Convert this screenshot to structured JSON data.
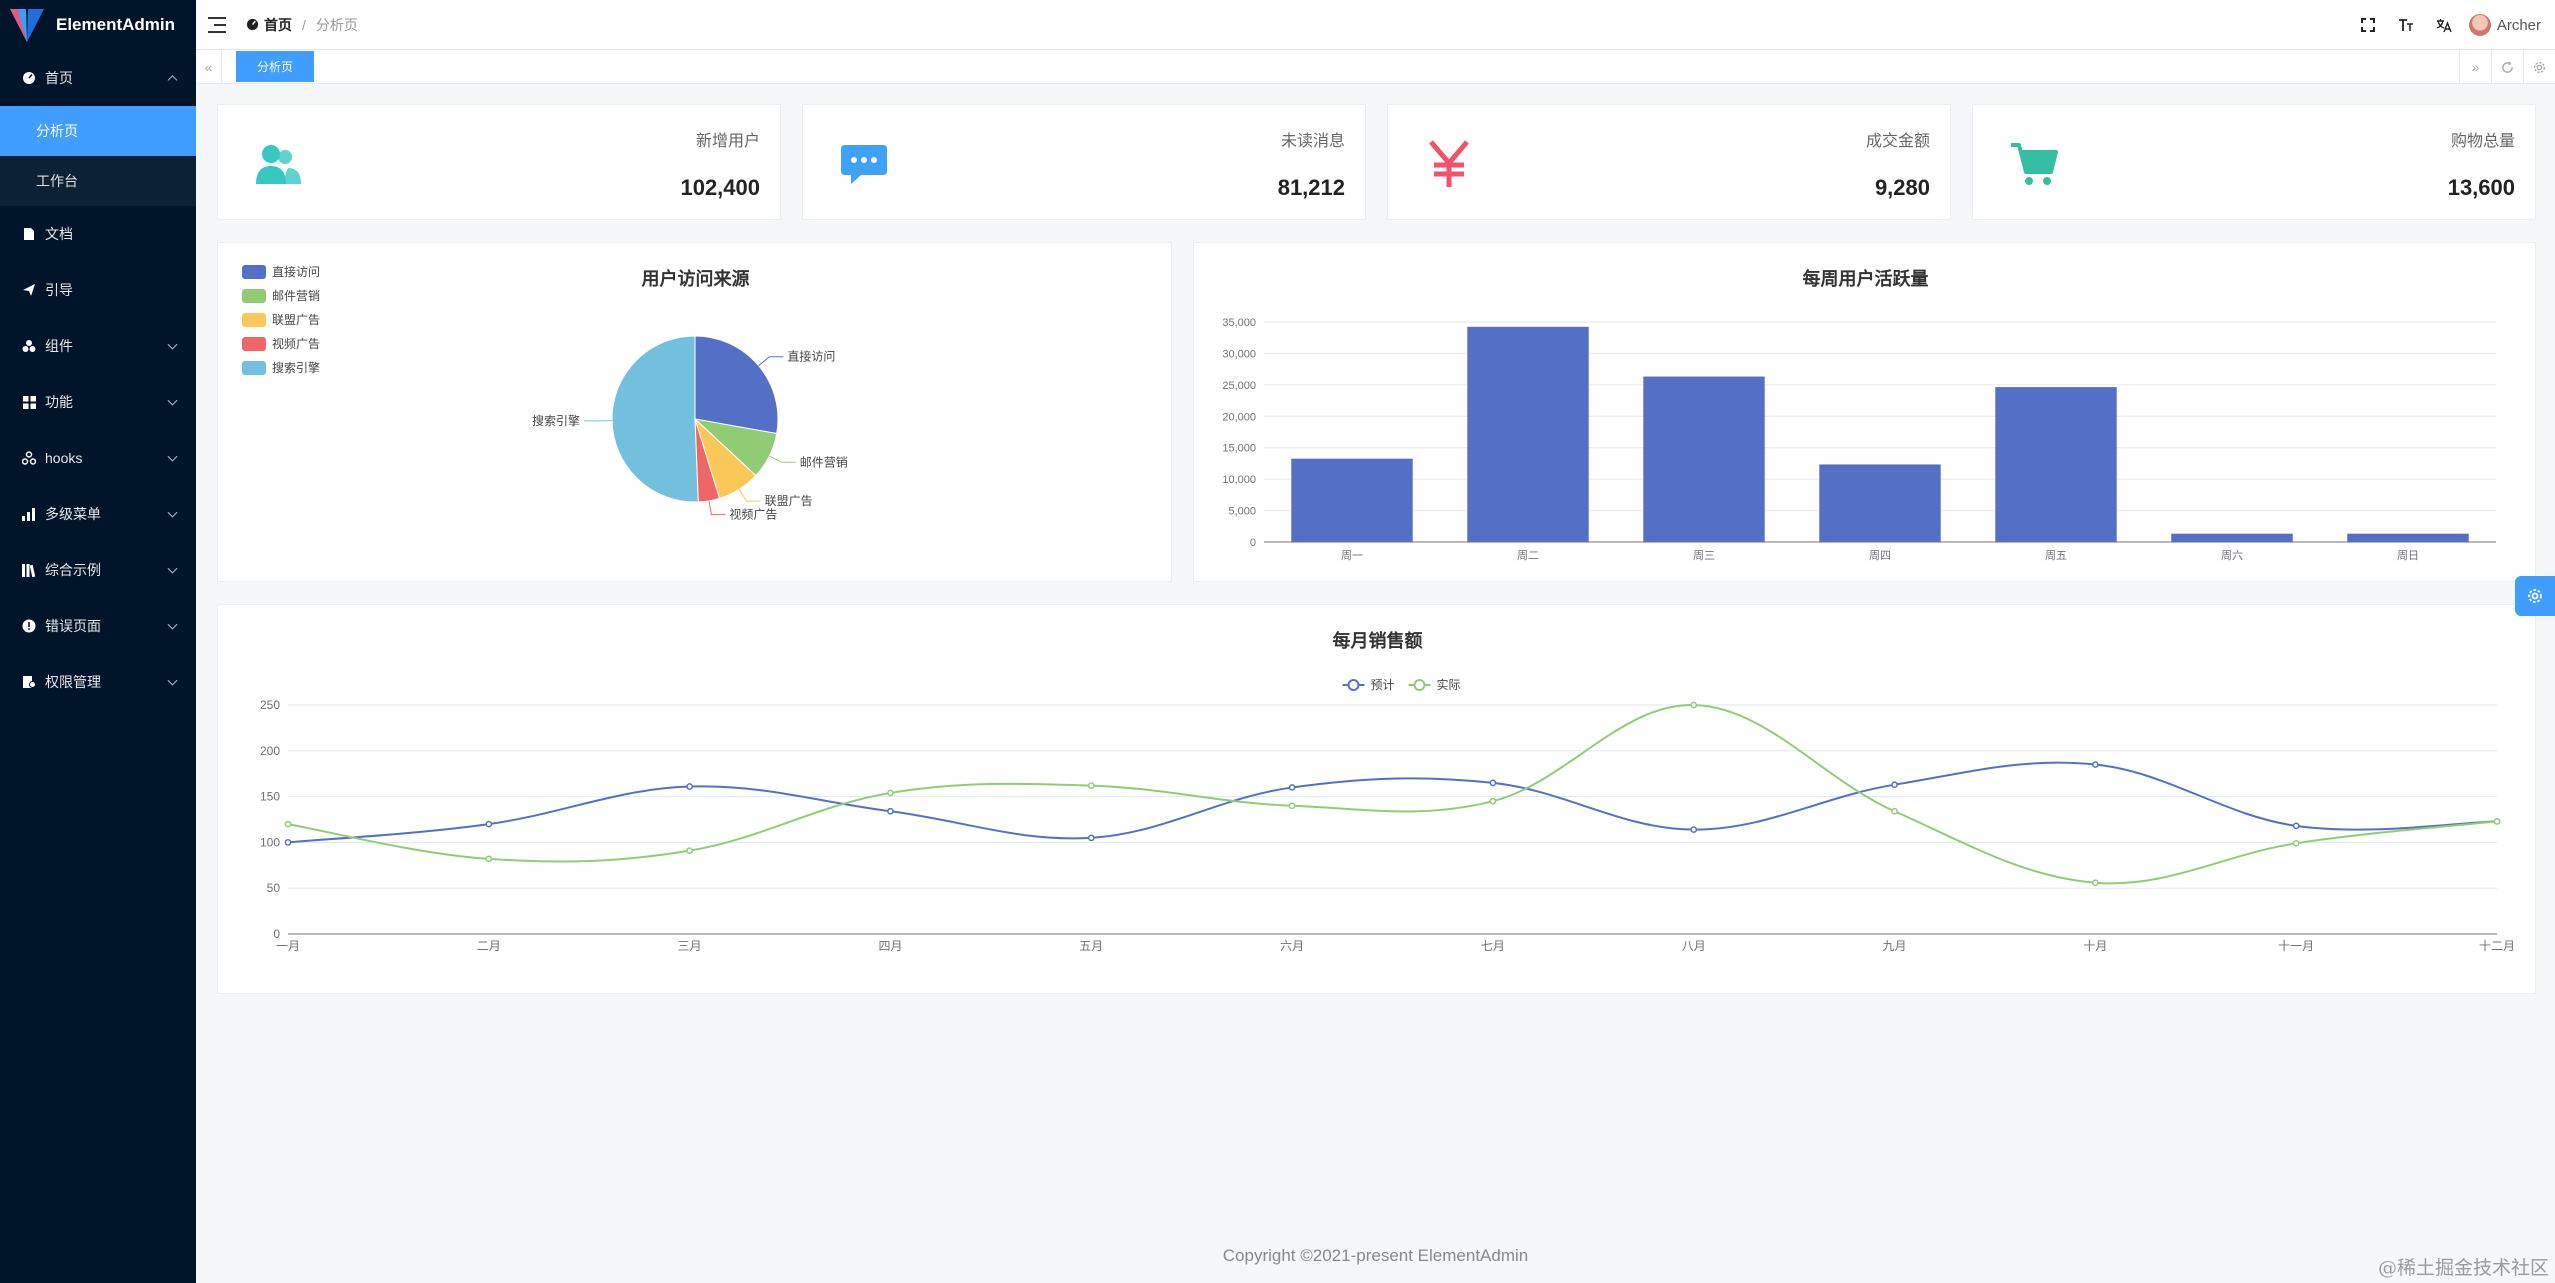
{
  "app": {
    "name": "ElementAdmin"
  },
  "sidebar": {
    "items": [
      {
        "label": "首页",
        "icon": "dashboard-icon",
        "expanded": true,
        "children": [
          {
            "label": "分析页",
            "active": true
          },
          {
            "label": "工作台",
            "active": false
          }
        ]
      },
      {
        "label": "文档",
        "icon": "document-icon"
      },
      {
        "label": "引导",
        "icon": "send-icon"
      },
      {
        "label": "组件",
        "icon": "component-icon",
        "has_children": true
      },
      {
        "label": "功能",
        "icon": "grid-icon",
        "has_children": true
      },
      {
        "label": "hooks",
        "icon": "hooks-icon",
        "has_children": true
      },
      {
        "label": "多级菜单",
        "icon": "bar-chart-icon",
        "has_children": true
      },
      {
        "label": "综合示例",
        "icon": "library-icon",
        "has_children": true
      },
      {
        "label": "错误页面",
        "icon": "exclamation-icon",
        "has_children": true
      },
      {
        "label": "权限管理",
        "icon": "lock-icon",
        "has_children": true
      }
    ]
  },
  "header": {
    "breadcrumb": {
      "home": "首页",
      "separator": "/",
      "current": "分析页"
    },
    "user": {
      "name": "Archer"
    }
  },
  "tabs": [
    {
      "label": "分析页",
      "active": true
    }
  ],
  "stats": [
    {
      "label": "新增用户",
      "value": "102,400",
      "icon": "users-icon",
      "color": "#36c8c1"
    },
    {
      "label": "未读消息",
      "value": "81,212",
      "icon": "message-icon",
      "color": "#40a2f6"
    },
    {
      "label": "成交金额",
      "value": "9,280",
      "icon": "yen-icon",
      "color": "#f4516c"
    },
    {
      "label": "购物总量",
      "value": "13,600",
      "icon": "cart-icon",
      "color": "#34bfa3"
    }
  ],
  "colors": {
    "primary": "#409eff",
    "sidebar_bg": "#001529"
  },
  "chart_data": [
    {
      "type": "pie",
      "title": "用户访问来源",
      "legend_position": "top-left",
      "categories": [
        "直接访问",
        "邮件营销",
        "联盟广告",
        "视频广告",
        "搜索引擎"
      ],
      "values": [
        335,
        110,
        100,
        50,
        610
      ],
      "colors": [
        "#5470c6",
        "#91cc75",
        "#fac858",
        "#ee6666",
        "#73c0de"
      ]
    },
    {
      "type": "bar",
      "title": "每周用户活跃量",
      "categories": [
        "周一",
        "周二",
        "周三",
        "周四",
        "周五",
        "周六",
        "周日"
      ],
      "values": [
        13253,
        34235,
        26321,
        12340,
        24643,
        1322,
        1324
      ],
      "ylim": [
        0,
        35000
      ],
      "yticks": [
        "0",
        "5,000",
        "10,000",
        "15,000",
        "20,000",
        "25,000",
        "30,000",
        "35,000"
      ],
      "color": "#5470c6",
      "grid": true
    },
    {
      "type": "line",
      "title": "每月销售额",
      "legend_position": "top-center",
      "categories": [
        "一月",
        "二月",
        "三月",
        "四月",
        "五月",
        "六月",
        "七月",
        "八月",
        "九月",
        "十月",
        "十一月",
        "十二月"
      ],
      "series": [
        {
          "name": "预计",
          "values": [
            100,
            120,
            161,
            134,
            105,
            160,
            165,
            114,
            163,
            185,
            118,
            123
          ],
          "color": "#5470c6"
        },
        {
          "name": "实际",
          "values": [
            120,
            82,
            91,
            154,
            162,
            140,
            145,
            250,
            134,
            56,
            99,
            123
          ],
          "color": "#91cc75"
        }
      ],
      "ylim": [
        0,
        250
      ],
      "yticks": [
        "0",
        "50",
        "100",
        "150",
        "200",
        "250"
      ],
      "smooth": true,
      "grid": true
    }
  ],
  "footer": {
    "copyright": "Copyright ©2021-present ElementAdmin"
  },
  "watermark": "@稀土掘金技术社区"
}
